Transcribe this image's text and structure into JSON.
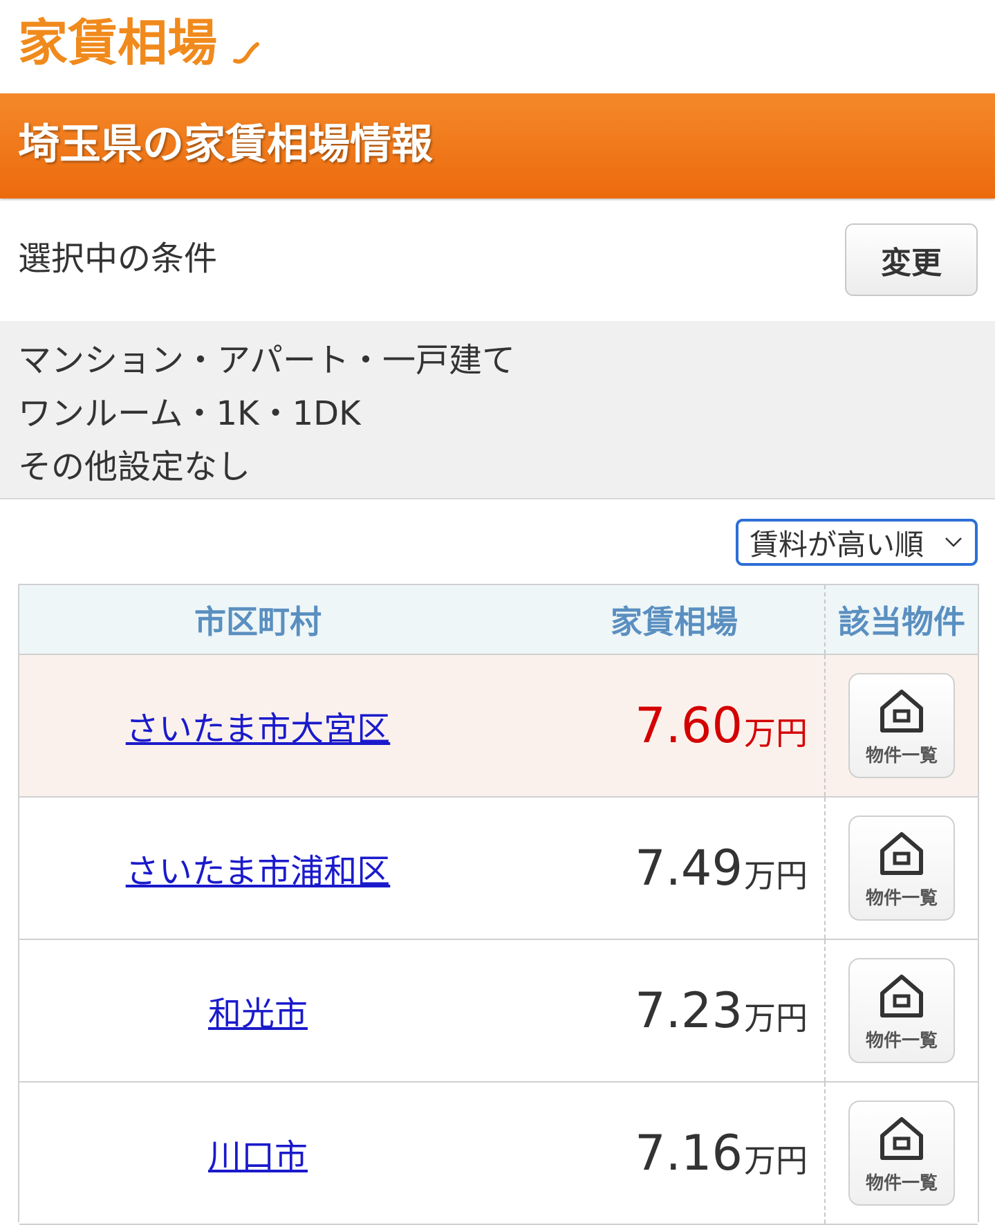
{
  "header": {
    "logo_text": "家賃相場"
  },
  "banner": {
    "title": "埼玉県の家賃相場情報"
  },
  "conditions": {
    "title": "選択中の条件",
    "change_label": "変更",
    "lines": [
      "マンション・アパート・一戸建て",
      "ワンルーム・1K・1DK",
      "その他設定なし"
    ]
  },
  "sort": {
    "selected": "賃料が高い順"
  },
  "table": {
    "headers": {
      "city": "市区町村",
      "rent": "家賃相場",
      "props": "該当物件"
    },
    "unit": "万円",
    "button_label": "物件一覧",
    "rows": [
      {
        "city": "さいたま市大宮区",
        "rent": "7.60",
        "highlight": true
      },
      {
        "city": "さいたま市浦和区",
        "rent": "7.49"
      },
      {
        "city": "和光市",
        "rent": "7.23"
      },
      {
        "city": "川口市",
        "rent": "7.16"
      }
    ]
  },
  "colors": {
    "brand_orange": "#ec6a0c",
    "link_blue": "#1a1acc",
    "highlight_red": "#d40000",
    "header_blue": "#5a8fc0"
  }
}
